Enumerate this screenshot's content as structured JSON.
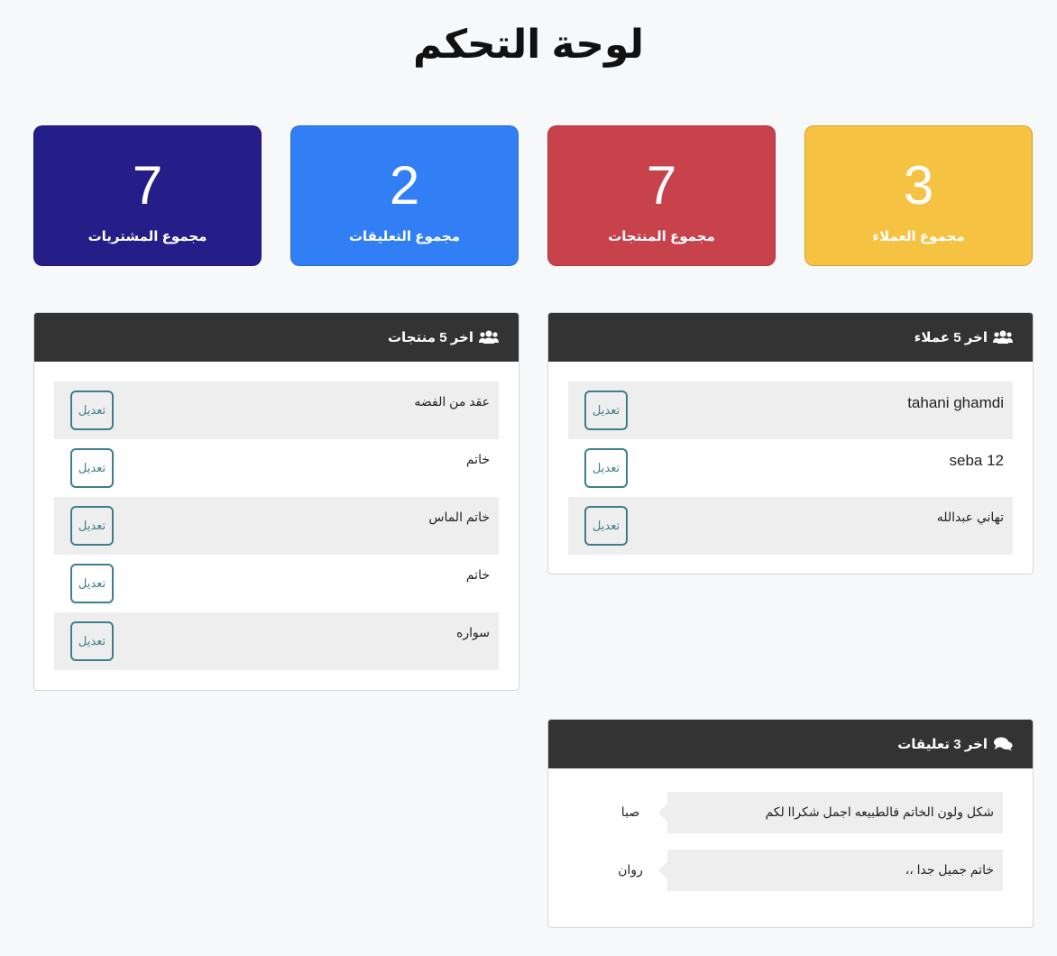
{
  "page": {
    "title": "لوحة التحكم"
  },
  "stats": [
    {
      "value": "3",
      "label": "مجموع العملاء",
      "color": "#f5c242"
    },
    {
      "value": "7",
      "label": "مجموع المنتجات",
      "color": "#c8424c"
    },
    {
      "value": "2",
      "label": "مجموع التعليقات",
      "color": "#327ff5"
    },
    {
      "value": "7",
      "label": "مجموع المشتريات",
      "color": "#251e89"
    }
  ],
  "customers_panel": {
    "title": "اخر 5 عملاء",
    "icon": "users-icon",
    "items": [
      {
        "name": "tahani ghamdi",
        "edit_label": "تعديل"
      },
      {
        "name": "seba 12",
        "edit_label": "تعديل"
      },
      {
        "name": "تهاني عبدالله",
        "edit_label": "تعديل"
      }
    ]
  },
  "products_panel": {
    "title": "اخر 5 منتجات",
    "icon": "users-icon",
    "items": [
      {
        "name": "عقد من الفضه",
        "edit_label": "تعديل"
      },
      {
        "name": "خاتم",
        "edit_label": "تعديل"
      },
      {
        "name": "خاتم الماس",
        "edit_label": "تعديل"
      },
      {
        "name": "خاتم",
        "edit_label": "تعديل"
      },
      {
        "name": "سواره",
        "edit_label": "تعديل"
      }
    ]
  },
  "comments_panel": {
    "title": "اخر 3 تعليقات",
    "icon": "comments-icon",
    "items": [
      {
        "text": "شكل ولون الخاتم فالطبيعه اجمل شكراا لكم",
        "author": "صبا"
      },
      {
        "text": "خاتم جميل جدا ،،",
        "author": "روان"
      }
    ]
  },
  "colors": {
    "panel_header": "#333333",
    "edit_button": "#3d7f8c",
    "stripe": "#eeeeee",
    "background": "#f7f8fa"
  }
}
